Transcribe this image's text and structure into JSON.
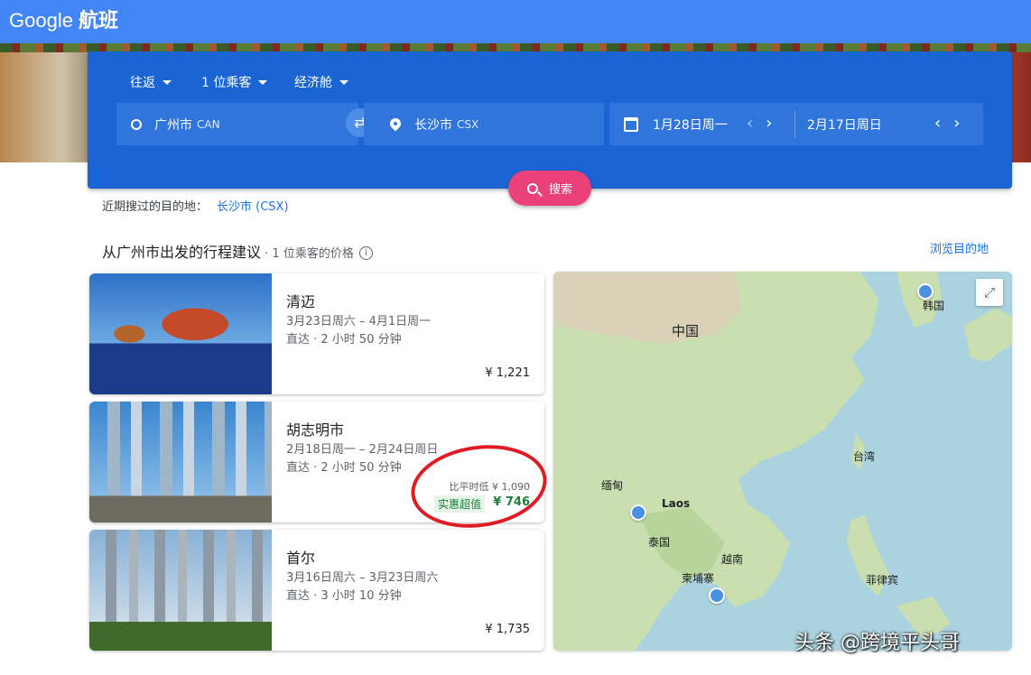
{
  "header": {
    "logo": "Google",
    "product": "航班"
  },
  "search": {
    "trip_type": "往返",
    "passengers": "1 位乘客",
    "cabin": "经济舱",
    "origin": {
      "city": "广州市",
      "code": "CAN"
    },
    "destination": {
      "city": "长沙市",
      "code": "CSX"
    },
    "depart_date": "1月28日周一",
    "return_date": "2月17日周日",
    "button_label": "搜索"
  },
  "recent": {
    "label": "近期搜过的目的地：",
    "link": "长沙市 (CSX)"
  },
  "suggestions": {
    "title": "从广州市出发的行程建议",
    "subtitle": " · 1 位乘客的价格",
    "info_icon": "i",
    "browse_link": "浏览目的地",
    "cards": [
      {
        "city": "清迈",
        "dates": "3月23日周六 – 4月1日周一",
        "duration": "直达 · 2 小时 50 分钟",
        "price": "¥ 1,221"
      },
      {
        "city": "胡志明市",
        "dates": "2月18日周一 – 2月24日周日",
        "duration": "直达 · 2 小时 50 分钟",
        "compare": "比平时低 ¥ 1,090",
        "deal_badge": "实惠超值",
        "price": "¥ 746"
      },
      {
        "city": "首尔",
        "dates": "3月16日周六 – 3月23日周六",
        "duration": "直达 · 3 小时 10 分钟",
        "price": "¥ 1,735"
      }
    ]
  },
  "map": {
    "labels": {
      "china": "中国",
      "korea": "韩国",
      "taiwan": "台湾",
      "myanmar": "缅甸",
      "laos": "Laos",
      "thailand": "泰国",
      "vietnam": "越南",
      "cambodia": "柬埔寨",
      "philippines": "菲律宾"
    }
  },
  "watermark": "头条 @跨境平头哥",
  "icons": {
    "swap": "⇄",
    "prev": "‹",
    "next": "›",
    "expand": "⤢"
  },
  "colors": {
    "topbar": "#4285f4",
    "panel": "#1a65d3",
    "search_button": "#ec407a",
    "deal": "#188038",
    "annotation": "#e01b24"
  }
}
